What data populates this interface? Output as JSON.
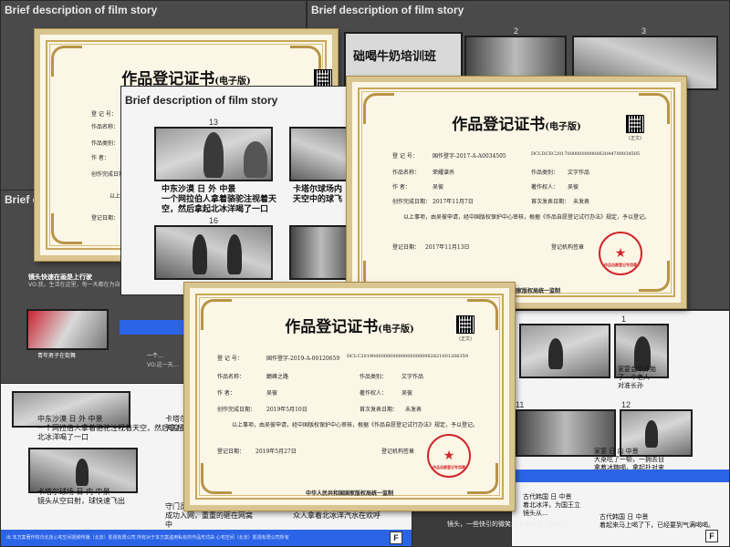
{
  "slides": {
    "title": "Brief description of film story",
    "frame_13": "13",
    "frame_16": "16",
    "frame_2": "2",
    "frame_3": "3",
    "frame_1": "1",
    "frame_11": "11",
    "frame_12": "12",
    "caption_13": "中东沙漠  日  外  中景\n一个网拉伯人拿着骆驼注视着天空，然后拿起北冰洋喝了一口",
    "caption_14": "卡塔尔球场内\n天空中的球飞",
    "caption_left_1": "镜头快速在画是上行驶",
    "caption_left_2": "VO:我，生活在这里，每一天都在为自己的梦想",
    "caption_left_3": "青年男子在街舞",
    "caption_left_4": "一个…",
    "caption_left_5": "VO:这一天…",
    "caption_bl_1": "中东沙漠  日  外  中景\n一个网拉伯人拿着骆驼注视着天空，然后拿起北冰洋喝了一口",
    "caption_bl_2": "卡塔尔球场内\n天空中的球",
    "caption_bl_3": "卡塔尔球场  日  内  中景\n镜头从空曰射，球快速飞出",
    "caption_bc": "守门员奋力扑救，但球还是成功入网，重重的砸在网窝中",
    "caption_bc2": "瞬间球场内气氛达到高点，众人拿着北冰洋汽水在欢呼",
    "caption_right_1": "家宴会中开始\n了一个老人\n对准长孙",
    "caption_right_2": "家宴  日  内  中景\n大桌吃了一顿，一拥去目\n拿着冰糖喝，拿起扑对来",
    "caption_right_3": "古代韩国  日  中景\n着北冰洋，为国王立\n镜头从…",
    "caption_br": "古代韩国  日  中景\n着起来马上喝了下，已经要到气满喝喝。",
    "caption_bottom": "镜头，一些快引的微笑北冰洋快速飞驰而过",
    "milk_banner": "础喝牛奶培训班",
    "footer": "出 本方案著作权归北京心宅空间视频传播（北京）影视有限公司 所有对于本方案盗用私有的作品形式由 心宅空间（北京）影视有限公司所有",
    "logo": "F"
  },
  "cert_main": {
    "title": "作品登记证书",
    "title_sub": "(电子版)",
    "qr_caption": "(正文)",
    "reg_no_label": "登  记  号：",
    "reg_no": "国作登字-2017-A-A0034505",
    "dci_label": "DCI:",
    "dci": "DCEC20170000000000062044700034505",
    "work_name_label": "作品名称：",
    "work_name": "荣耀谍杀",
    "work_type_label": "作品类别：",
    "work_type": "文字作品",
    "author_label": "作      者：",
    "author": "吴彼",
    "owner_label": "著作权人：",
    "owner": "吴彼",
    "created_label": "创作完成日期：",
    "created": "2017年11月7日",
    "published_label": "首次发表日期：",
    "published": "未发表",
    "statement": "以上事项，由吴彼申请，经中国版权保护中心审核，根据《作品自愿登记试行办法》规定，予以登记。",
    "reg_date_label": "登记日期：",
    "reg_date": "2017年11月13日",
    "agency_label": "登记机构签章",
    "seal_text": "作品自愿登记专用章",
    "issuer": "中华人民共和国国家版权局统一监制"
  },
  "cert_front": {
    "title": "作品登记证书",
    "title_sub": "(电子版)",
    "qr_caption": "(正文)",
    "reg_no_label": "登  记  号：",
    "reg_no": "国作登字-2019-A-00120659",
    "dci_label": "DCI:",
    "dci": "C2019000000000000000000982821001206359",
    "work_name_label": "作品名称：",
    "work_name": "巅峰之路",
    "work_type_label": "作品类别：",
    "work_type": "文字作品",
    "author_label": "作      者：",
    "author": "吴彼",
    "owner_label": "著作权人：",
    "owner": "吴彼",
    "created_label": "创作完成日期：",
    "created": "2019年5月10日",
    "published_label": "首次发表日期：",
    "published": "未发表",
    "statement": "以上事项，由吴彼申请，经中国版权保护中心审核，根据《作品自愿登记试行办法》规定，予以登记。",
    "reg_date_label": "登记日期：",
    "reg_date": "2019年5月27日",
    "agency_label": "登记机构签章",
    "seal_text": "作品自愿登记专用章",
    "issuer": "中华人民共和国国家版权局统一监制"
  },
  "cert_back": {
    "title": "作品登记证书",
    "title_sub": "(电子版)",
    "reg_no_label": "登  记  号：",
    "reg_no_partial": "国作",
    "work_name_label": "作品名称：",
    "work_name_partial": "时",
    "work_type_label": "作品类别：",
    "author_label": "作      者：",
    "author_partial": "吴",
    "created_label": "创作完成日期：",
    "created_partial": "201",
    "statement_partial": "以上事项，由",
    "reg_date_label": "登记日期：",
    "reg_date_partial": "201"
  }
}
